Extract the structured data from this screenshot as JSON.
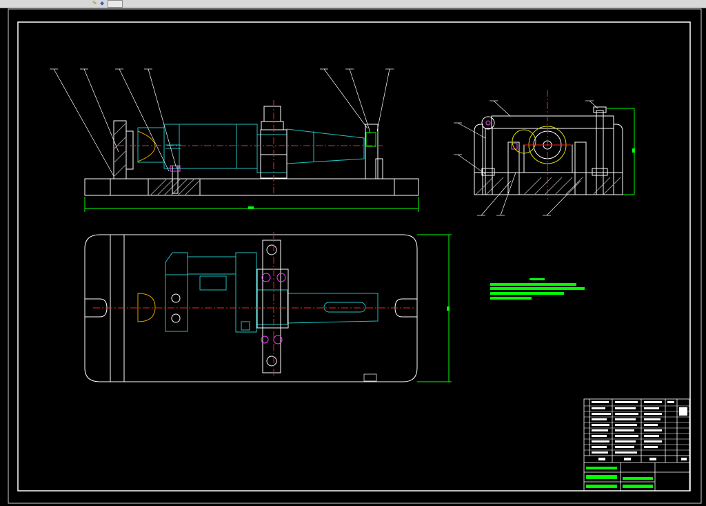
{
  "window": {
    "toolbar_icons": [
      "paint-icon",
      "shape-icon"
    ]
  },
  "colors": {
    "background": "#000000",
    "frame": "#ffffff",
    "part_outline": "#20c0c0",
    "center_line": "#ff2020",
    "dimension": "#00ff00",
    "highlight": "#ff40ff",
    "hatch": "#a0a0a0",
    "yellow": "#e0e000"
  },
  "drawing": {
    "leaders_front": [
      "1",
      "2",
      "3",
      "4",
      "5",
      "6",
      "7"
    ],
    "leaders_side": [
      "8",
      "9",
      "10",
      "11",
      "12",
      "13",
      "14"
    ]
  }
}
